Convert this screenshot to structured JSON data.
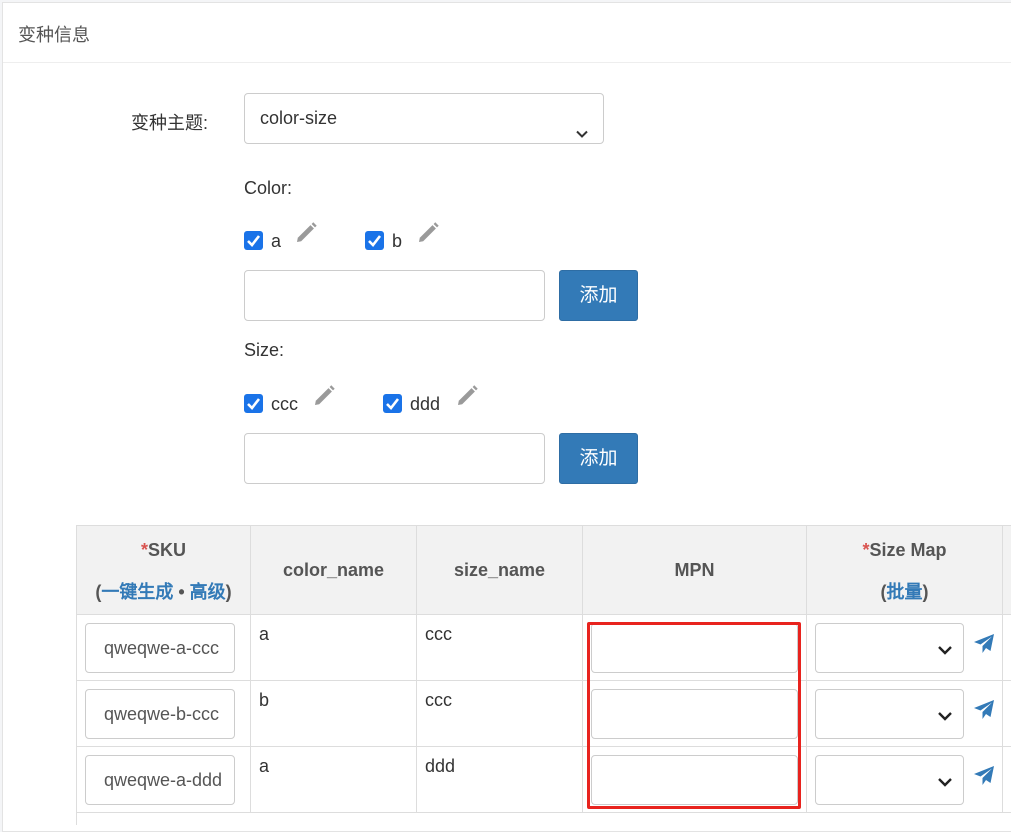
{
  "panel": {
    "title": "变种信息"
  },
  "theme": {
    "label": "变种主题:",
    "selected": "color-size"
  },
  "attributes": [
    {
      "label": "Color:",
      "options": [
        {
          "value": "a",
          "checked": true
        },
        {
          "value": "b",
          "checked": true
        }
      ],
      "add_label": "添加",
      "input_value": ""
    },
    {
      "label": "Size:",
      "options": [
        {
          "value": "ccc",
          "checked": true
        },
        {
          "value": "ddd",
          "checked": true
        }
      ],
      "add_label": "添加",
      "input_value": ""
    }
  ],
  "table": {
    "headers": {
      "sku": {
        "required_mark": "*",
        "title": "SKU",
        "open_paren": "(",
        "generate": "一键生成",
        "separator": " • ",
        "advanced": "高级",
        "close_paren": ")"
      },
      "color_name": "color_name",
      "size_name": "size_name",
      "mpn": "MPN",
      "size_map": {
        "required_mark": "*",
        "title": "Size Map",
        "open_paren": "(",
        "batch": "批量",
        "close_paren": ")"
      }
    },
    "rows": [
      {
        "sku": "qweqwe-a-ccc",
        "color_name": "a",
        "size_name": "ccc",
        "mpn": "",
        "size_map": ""
      },
      {
        "sku": "qweqwe-b-ccc",
        "color_name": "b",
        "size_name": "ccc",
        "mpn": "",
        "size_map": ""
      },
      {
        "sku": "qweqwe-a-ddd",
        "color_name": "a",
        "size_name": "ddd",
        "mpn": "",
        "size_map": ""
      }
    ]
  },
  "colors": {
    "primary": "#337ab7",
    "checkbox": "#1a73e8",
    "required": "#d9534f",
    "highlight": "#e8231e"
  }
}
